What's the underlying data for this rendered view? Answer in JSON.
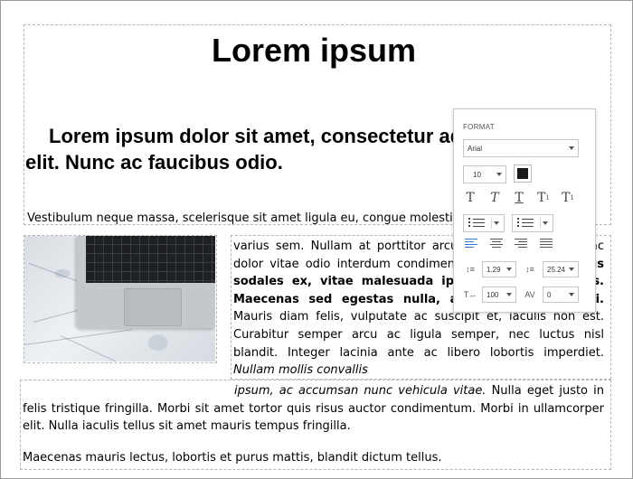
{
  "doc": {
    "title": "Lorem ipsum",
    "subtitle_line1": "Lorem ipsum dolor sit amet, consectetur adipiscing",
    "subtitle_line2": "elit. Nunc ac faucibus odio.",
    "body_line": "Vestibulum neque massa, scelerisque sit amet ligula eu, congue molestie mi. Praesent ut",
    "right_para": {
      "p1": "varius sem. Nullam at porttitor arcu, nec lacinia nisi. Ut ac dolor vitae odio interdum condimentum. ",
      "p2_bold": "Vivamus dapibus sodales ex, vitae malesuada ipsum cursus convallis. Maecenas sed egestas nulla, ac condimentum orci.",
      "p3": " Mauris diam felis, vulputate ac suscipit et, iaculis non est. Curabitur semper arcu ac ligula semper, nec luctus nisl blandit. Integer lacinia ante ac libero lobortis imperdiet. ",
      "p4_italic": "Nullam mollis convallis"
    },
    "bottom_para": {
      "italic": "ipsum, ac accumsan nunc vehicula vitae.",
      "text": " Nulla eget justo in felis tristique fringilla. Morbi sit amet tortor quis risus auctor condimentum. Morbi in ullamcorper elit. Nulla iaculis tellus sit amet mauris tempus fringilla."
    },
    "last_line": "Maecenas mauris lectus, lobortis et purus mattis, blandit dictum tellus."
  },
  "format_panel": {
    "heading": "FORMAT",
    "font_family": "Arial",
    "font_size": "10",
    "text_color": "#1a1a1a",
    "line_height": "1.29",
    "paragraph_spacing": "25.24",
    "word_spacing": "100",
    "char_spacing": "0",
    "active_alignment": "left",
    "accent_color": "#2d7fd3"
  }
}
